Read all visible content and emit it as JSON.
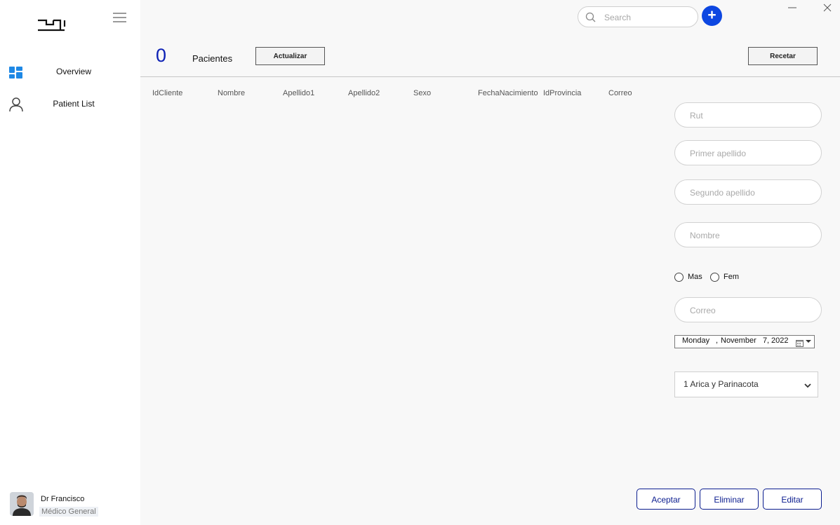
{
  "window": {
    "minimize_icon": "minimize-icon",
    "close_icon": "close-icon"
  },
  "sidebar": {
    "logo_icon": "app-logo",
    "menu_icon": "hamburger-icon",
    "items": [
      {
        "label": "Overview",
        "icon": "dashboard-icon",
        "icon_color": "#1e88e5"
      },
      {
        "label": "Patient List",
        "icon": "person-icon"
      }
    ],
    "user": {
      "name": "Dr Francisco",
      "role": "Médico General"
    }
  },
  "header": {
    "search": {
      "placeholder": "Search",
      "value": "",
      "icon": "search-icon"
    },
    "add_icon": "plus-icon",
    "accent_color": "#0d47e1"
  },
  "summary": {
    "count": "0",
    "label": "Pacientes",
    "refresh_label": "Actualizar",
    "prescribe_label": "Recetar"
  },
  "table": {
    "columns": [
      "IdCliente",
      "Nombre",
      "Apellido1",
      "Apellido2",
      "Sexo",
      "FechaNacimiento",
      "IdProvincia",
      "Correo"
    ],
    "rows": []
  },
  "form": {
    "rut": {
      "placeholder": "Rut",
      "value": ""
    },
    "apellido1": {
      "placeholder": "Primer apellido",
      "value": ""
    },
    "apellido2": {
      "placeholder": "Segundo apellido",
      "value": ""
    },
    "nombre": {
      "placeholder": "Nombre",
      "value": ""
    },
    "sexo": {
      "options": [
        "Mas",
        "Fem"
      ],
      "selected": null
    },
    "correo": {
      "placeholder": "Correo",
      "value": ""
    },
    "fecha": {
      "weekday": "Monday",
      "month": "November",
      "day": "7",
      "year": "2022"
    },
    "provincia": {
      "selected": "1 Arica y Parinacota"
    }
  },
  "actions": {
    "accept_label": "Aceptar",
    "delete_label": "Eliminar",
    "edit_label": "Editar",
    "color": "#0b1d8f"
  }
}
